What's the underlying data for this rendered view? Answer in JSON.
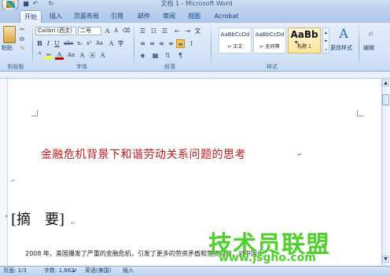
{
  "window": {
    "title": "文档 1 - Microsoft Word"
  },
  "tabs": [
    "开始",
    "插入",
    "页面布局",
    "引用",
    "邮件",
    "审阅",
    "视图",
    "Acrobat"
  ],
  "clipboard": {
    "paste_label": "粘贴",
    "group_label": "剪贴板"
  },
  "font": {
    "family": "Calibri (西文)",
    "size": "二号",
    "group_label": "字体",
    "font_color": "#c00000",
    "highlight": "#ffff00"
  },
  "paragraph": {
    "group_label": "段落"
  },
  "styles": {
    "group_label": "样式",
    "items": [
      {
        "preview": "AaBbCcDd",
        "name": "↵ 正文"
      },
      {
        "preview": "AaBbCcDd",
        "name": "↵ 无间隔"
      },
      {
        "preview": "AaBb",
        "name": "标题 1"
      }
    ],
    "change_label": "更改样式"
  },
  "editing": {
    "label": "编辑"
  },
  "document": {
    "title": "金融危机背景下和谐劳动关系问题的思考",
    "abstract_heading": "[摘　要]",
    "body_line": "2008 年，美国爆发了严重的金融危机，引发了更多的劳资矛盾和劳资纠纷，对中国企",
    "title_color": "#c0161a"
  },
  "watermark": {
    "text": "技术员联盟",
    "url": "www.jsgho.com",
    "color": "#4fd12c"
  },
  "status": {
    "page": "页面: 1/3",
    "words": "字数: 1,662",
    "language": "英语(美国)",
    "mode": "插入"
  }
}
